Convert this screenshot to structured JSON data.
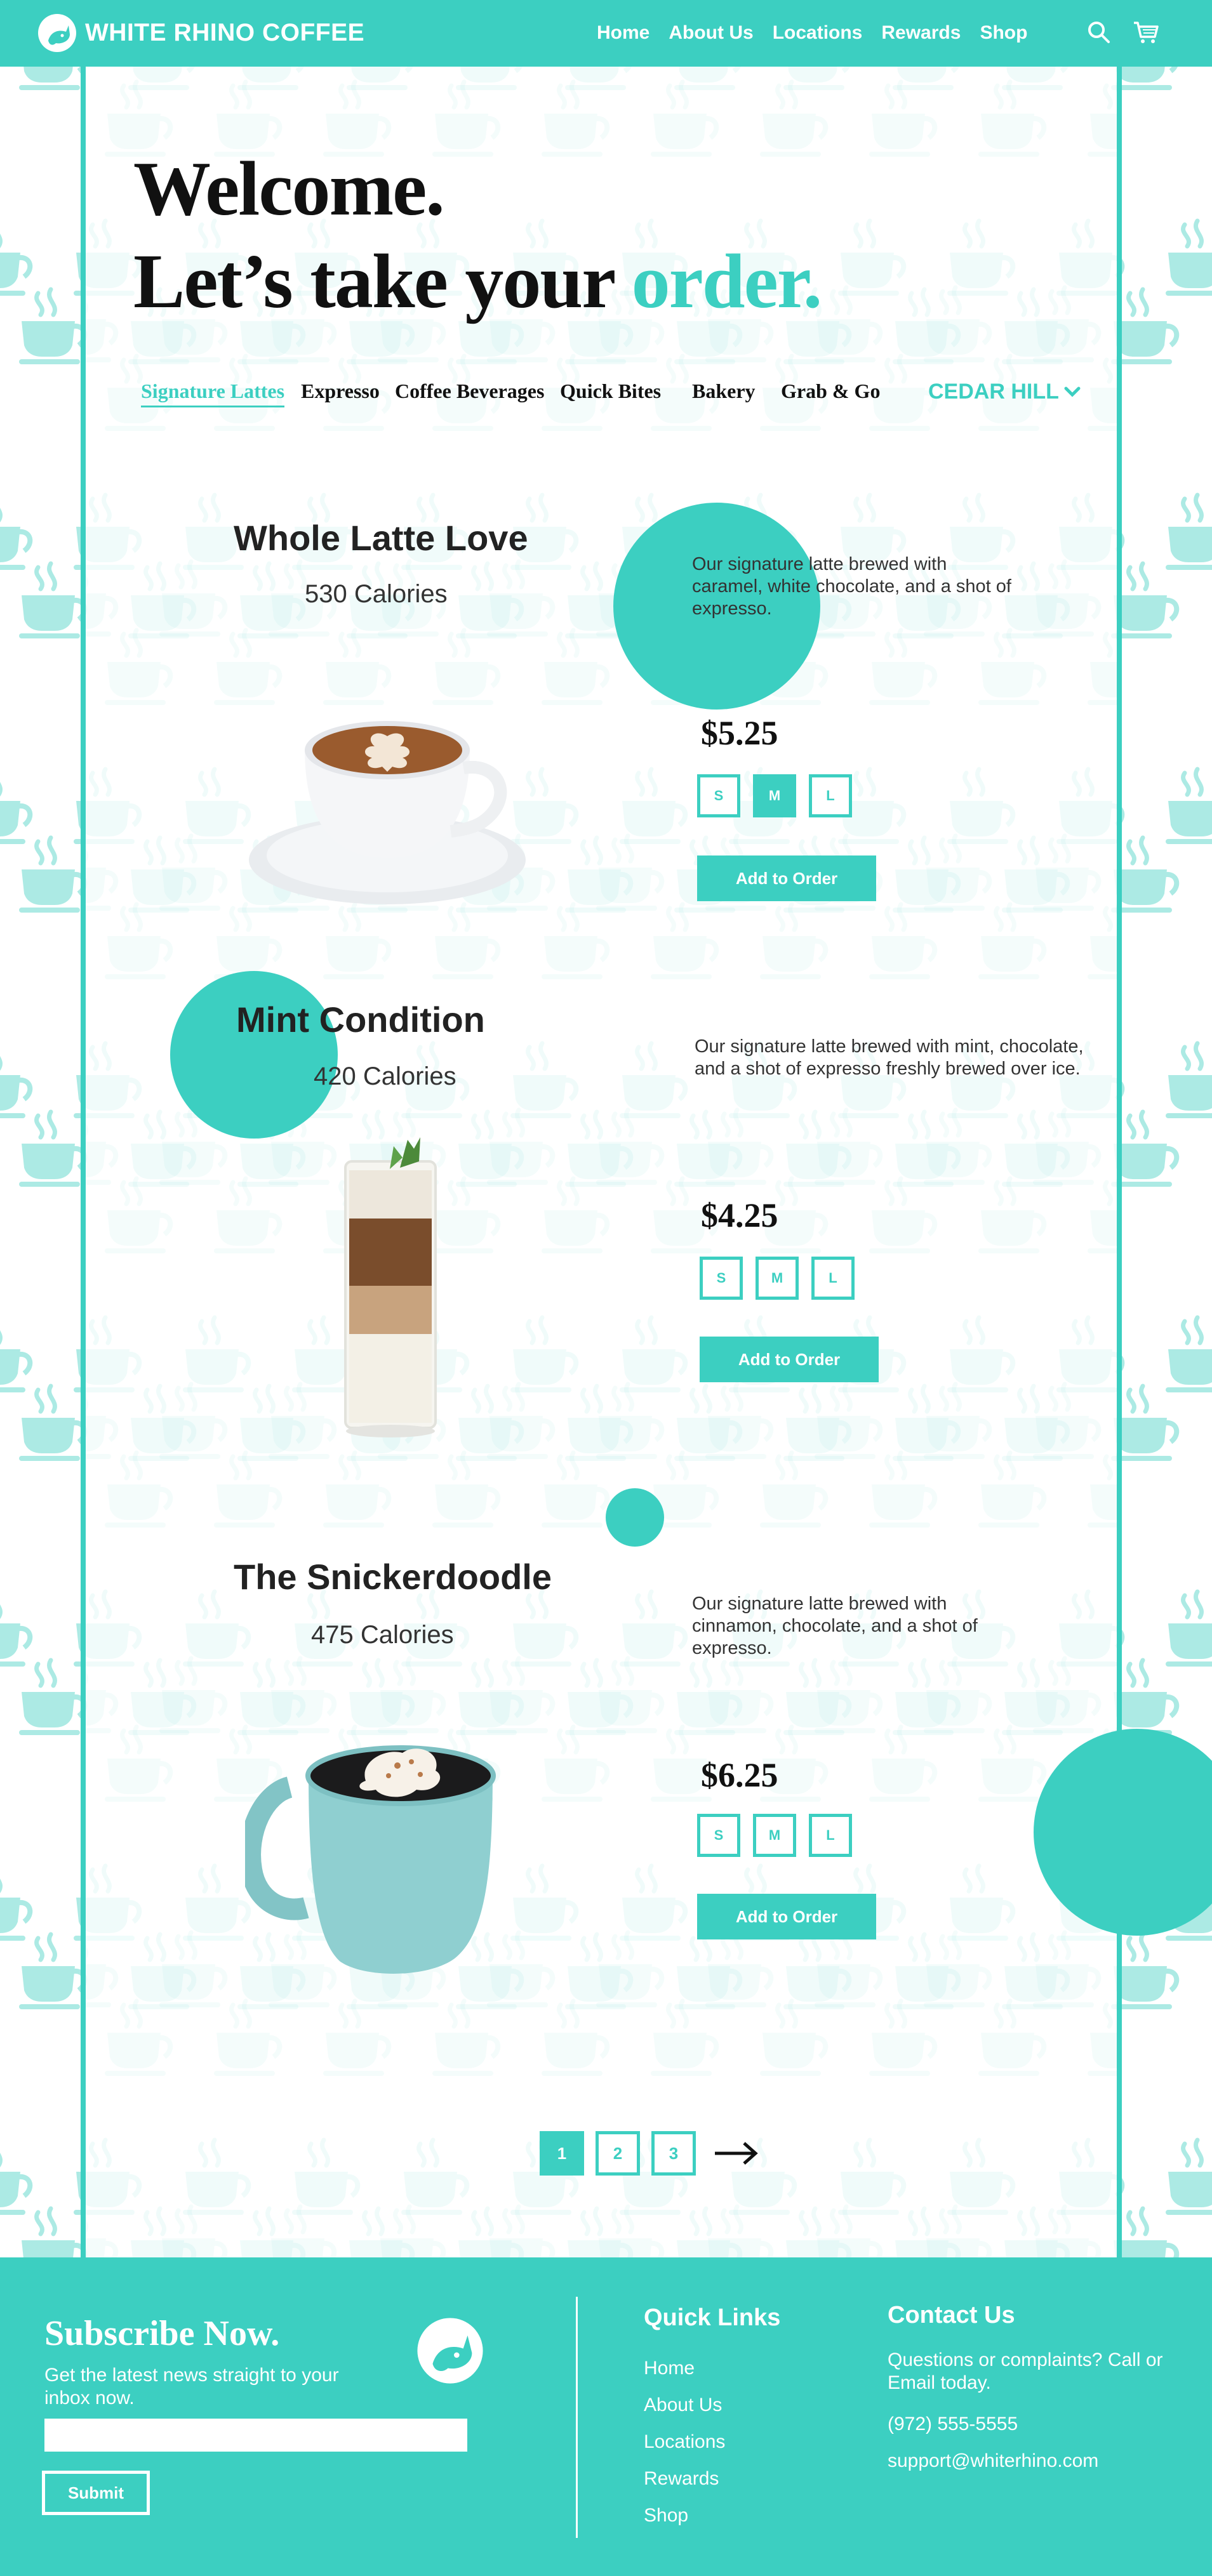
{
  "brand": {
    "name": "WHITE RHINO COFFEE",
    "accent": "#3ccfc1"
  },
  "nav": {
    "items": [
      "Home",
      "About Us",
      "Locations",
      "Rewards",
      "Shop"
    ]
  },
  "header_icons": [
    "search-icon",
    "cart-icon"
  ],
  "hero": {
    "line1": "Welcome.",
    "line2_prefix": "Let’s take your ",
    "line2_accent": "order."
  },
  "categories": [
    "Signature Lattes",
    "Expresso",
    "Coffee Beverages",
    "Quick Bites",
    "Bakery",
    "Grab & Go"
  ],
  "location": "CEDAR HILL",
  "sizes": [
    "S",
    "M",
    "L"
  ],
  "add_label": "Add to Order",
  "items": [
    {
      "name": "Whole Latte Love",
      "calories": "530 Calories",
      "description": "Our signature latte brewed with caramel, white chocolate, and a shot of expresso.",
      "price": "$5.25",
      "selected_size": "M"
    },
    {
      "name": "Mint Condition",
      "calories": "420 Calories",
      "description": "Our signature latte brewed with mint, chocolate, and a shot of expresso freshly brewed over ice.",
      "price": "$4.25",
      "selected_size": ""
    },
    {
      "name": "The Snickerdoodle",
      "calories": "475 Calories",
      "description": "Our signature latte brewed with cinnamon, chocolate, and a shot of expresso.",
      "price": "$6.25",
      "selected_size": ""
    }
  ],
  "pagination": {
    "pages": [
      "1",
      "2",
      "3"
    ],
    "current": "1"
  },
  "footer": {
    "subscribe_title": "Subscribe Now.",
    "subscribe_text": "Get the latest news straight to your inbox now.",
    "submit_label": "Submit",
    "quick_links_title": "Quick Links",
    "quick_links": [
      "Home",
      "About Us",
      "Locations",
      "Rewards",
      "Shop"
    ],
    "contact_title": "Contact Us",
    "contact_text": "Questions or complaints? Call or Email today.",
    "phone": "(972) 555-5555",
    "email": "support@whiterhino.com"
  }
}
